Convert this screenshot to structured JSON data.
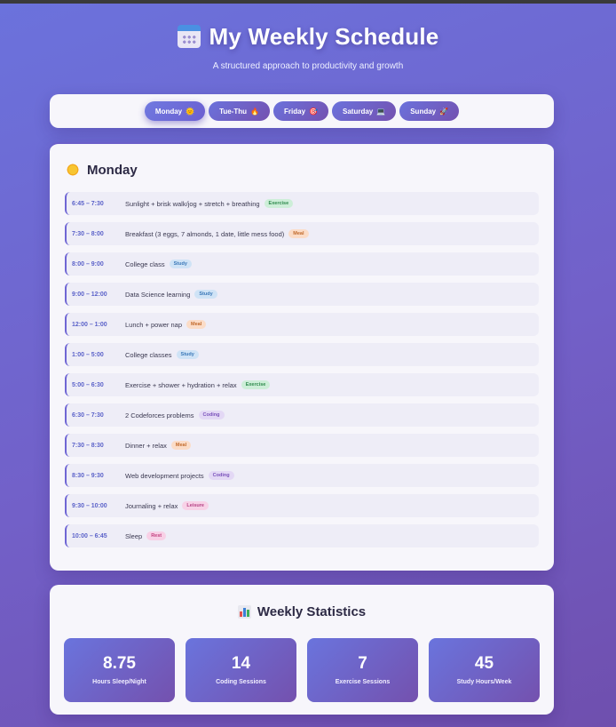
{
  "header": {
    "title": "My Weekly Schedule",
    "subtitle": "A structured approach to productivity and growth",
    "icon": "calendar-icon"
  },
  "tabs": [
    {
      "label": "Monday",
      "emoji": "🌞",
      "active": true
    },
    {
      "label": "Tue-Thu",
      "emoji": "🔥",
      "active": false
    },
    {
      "label": "Friday",
      "emoji": "🎯",
      "active": false
    },
    {
      "label": "Saturday",
      "emoji": "💻",
      "active": false
    },
    {
      "label": "Sunday",
      "emoji": "🚀",
      "active": false
    }
  ],
  "schedule": {
    "day_title": "Monday",
    "day_icon": "sun-icon",
    "rows": [
      {
        "time": "6:45 – 7:30",
        "activity": "Sunlight + brisk walk/jog + stretch + breathing",
        "tag": "Exercise"
      },
      {
        "time": "7:30 – 8:00",
        "activity": "Breakfast (3 eggs, 7 almonds, 1 date, little mess food)",
        "tag": "Meal"
      },
      {
        "time": "8:00 – 9:00",
        "activity": "College class",
        "tag": "Study"
      },
      {
        "time": "9:00 – 12:00",
        "activity": "Data Science learning",
        "tag": "Study"
      },
      {
        "time": "12:00 – 1:00",
        "activity": "Lunch + power nap",
        "tag": "Meal"
      },
      {
        "time": "1:00 – 5:00",
        "activity": "College classes",
        "tag": "Study"
      },
      {
        "time": "5:00 – 6:30",
        "activity": "Exercise + shower + hydration + relax",
        "tag": "Exercise"
      },
      {
        "time": "6:30 – 7:30",
        "activity": "2 Codeforces problems",
        "tag": "Coding"
      },
      {
        "time": "7:30 – 8:30",
        "activity": "Dinner + relax",
        "tag": "Meal"
      },
      {
        "time": "8:30 – 9:30",
        "activity": "Web development projects",
        "tag": "Coding"
      },
      {
        "time": "9:30 – 10:00",
        "activity": "Journaling + relax",
        "tag": "Leisure"
      },
      {
        "time": "10:00 – 6:45",
        "activity": "Sleep",
        "tag": "Rest"
      }
    ]
  },
  "stats": {
    "title": "Weekly Statistics",
    "icon": "bar-chart-icon",
    "items": [
      {
        "value": "8.75",
        "label": "Hours Sleep/Night"
      },
      {
        "value": "14",
        "label": "Coding Sessions"
      },
      {
        "value": "7",
        "label": "Exercise Sessions"
      },
      {
        "value": "45",
        "label": "Study Hours/Week"
      }
    ]
  },
  "colors": {
    "accent": "#6b72dc",
    "accent_dark": "#7451b0",
    "exercise": "#2f8a4d",
    "meal": "#c26a2c",
    "study": "#3a78b8",
    "coding": "#7a52bb",
    "leisure": "#b54285",
    "rest": "#c2407f"
  }
}
